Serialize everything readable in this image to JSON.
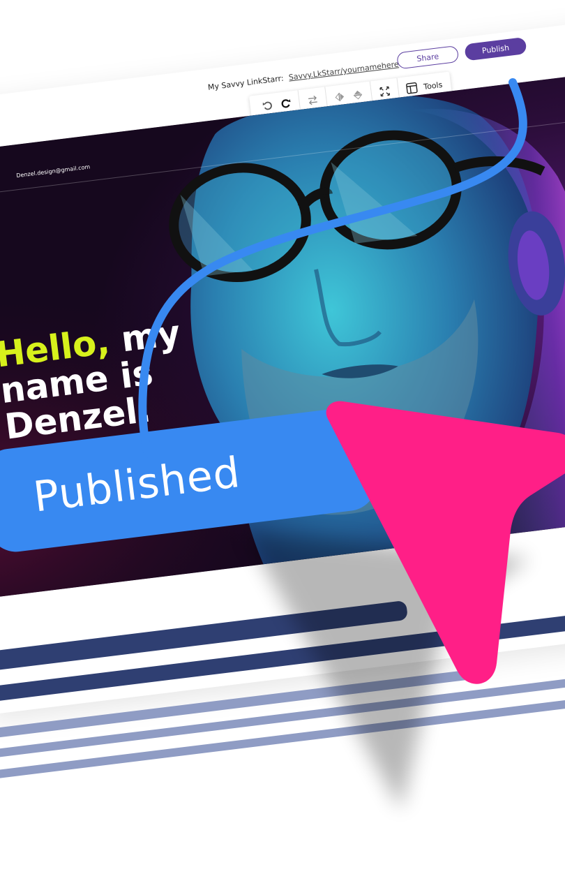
{
  "editor": {
    "site_label": "My Savvy LinkStarr:",
    "site_url": "Savvy.LkStarr/yournamehere",
    "share_label": "Share",
    "publish_label": "Publish",
    "tools_label": "Tools"
  },
  "hero": {
    "email": "Denzel.design@gmail.com",
    "heading_line1_accent": "Hello,",
    "heading_line1_rest": " my",
    "heading_line2": "name is",
    "heading_line3": "Denzel."
  },
  "badge": {
    "label": "Published"
  },
  "colors": {
    "brand_purple": "#5b3ea0",
    "badge_blue": "#3889f1",
    "cursor_pink": "#ff1f87",
    "accent_lime": "#d7f11c",
    "stripe_navy": "#2f3f72",
    "stripe_light": "#8f9cc4"
  },
  "icons": [
    "undo-icon",
    "redo-icon",
    "swap-icon",
    "flip-horizontal-icon",
    "flip-vertical-icon",
    "fullscreen-icon",
    "tools-panel-icon",
    "menu-icon"
  ]
}
